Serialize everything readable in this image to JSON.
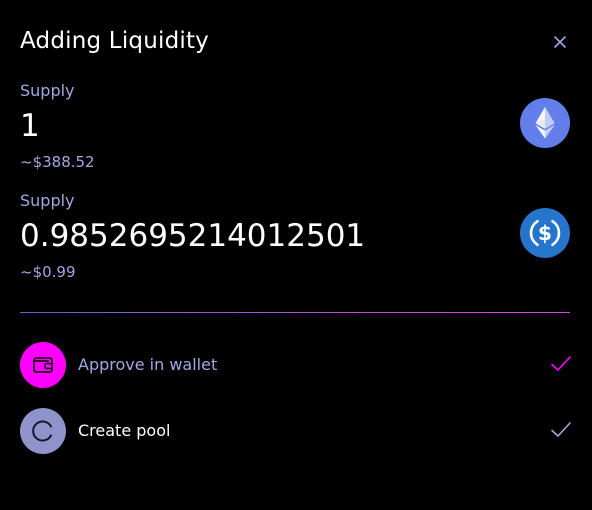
{
  "modal": {
    "title": "Adding Liquidity"
  },
  "supplies": [
    {
      "label": "Supply",
      "amount": "1",
      "usd": "~$388.52",
      "token_icon": "ethereum-icon",
      "token_color": "#627eea"
    },
    {
      "label": "Supply",
      "amount": "0.9852695214012501",
      "usd": "~$0.99",
      "token_icon": "usdc-icon",
      "token_color": "#2775ca"
    }
  ],
  "steps": [
    {
      "label": "Approve in wallet",
      "icon": "wallet-icon",
      "icon_bg": "#ff00ff",
      "check_color": "#ff00ff",
      "completed": true
    },
    {
      "label": "Create pool",
      "icon": "spinner-icon",
      "icon_bg": "#8f93c9",
      "check_color": "#a3a7e0",
      "completed": false
    }
  ],
  "colors": {
    "background": "#000000",
    "muted_text": "#a3a7e0",
    "accent": "#ff00ff"
  }
}
